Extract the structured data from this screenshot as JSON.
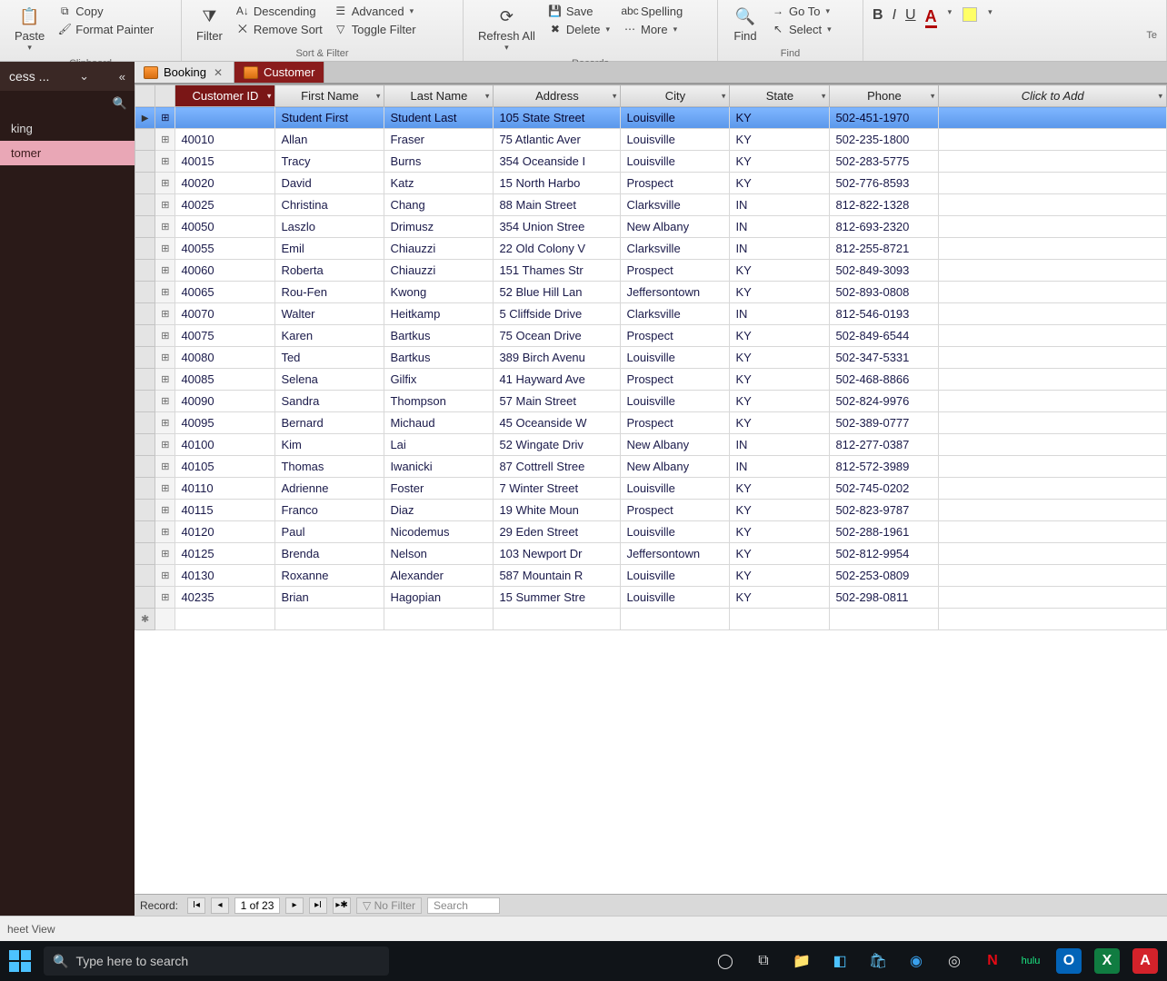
{
  "ribbon": {
    "clipboard": {
      "paste": "Paste",
      "copy": "Copy",
      "painter": "Format Painter",
      "group": "Clipboard"
    },
    "sortfilter": {
      "filter": "Filter",
      "desc": "Descending",
      "remove": "Remove Sort",
      "adv": "Advanced",
      "toggle": "Toggle Filter",
      "group": "Sort & Filter"
    },
    "records": {
      "refresh": "Refresh All",
      "save": "Save",
      "delete": "Delete",
      "spelling": "Spelling",
      "more": "More",
      "group": "Records"
    },
    "find": {
      "find": "Find",
      "goto": "Go To",
      "select": "Select",
      "group": "Find"
    },
    "textfmt": {
      "group": "Te"
    }
  },
  "nav": {
    "title": "cess ...",
    "items": [
      {
        "label": "king"
      },
      {
        "label": "tomer"
      }
    ]
  },
  "tabs": [
    {
      "label": "Booking",
      "active": false
    },
    {
      "label": "Customer",
      "active": true
    }
  ],
  "columns": [
    "Customer ID",
    "First Name",
    "Last Name",
    "Address",
    "City",
    "State",
    "Phone",
    "Click to Add"
  ],
  "rows": [
    {
      "id": "",
      "fn": "Student First",
      "ln": "Student Last",
      "addr": "105 State Street",
      "city": "Louisville",
      "state": "KY",
      "phone": "502-451-1970",
      "sel": true
    },
    {
      "id": "40010",
      "fn": "Allan",
      "ln": "Fraser",
      "addr": "75 Atlantic Aver",
      "city": "Louisville",
      "state": "KY",
      "phone": "502-235-1800"
    },
    {
      "id": "40015",
      "fn": "Tracy",
      "ln": "Burns",
      "addr": "354 Oceanside I",
      "city": "Louisville",
      "state": "KY",
      "phone": "502-283-5775"
    },
    {
      "id": "40020",
      "fn": "David",
      "ln": "Katz",
      "addr": "15 North Harbo",
      "city": "Prospect",
      "state": "KY",
      "phone": "502-776-8593"
    },
    {
      "id": "40025",
      "fn": "Christina",
      "ln": "Chang",
      "addr": "88 Main Street",
      "city": "Clarksville",
      "state": "IN",
      "phone": "812-822-1328"
    },
    {
      "id": "40050",
      "fn": "Laszlo",
      "ln": "Drimusz",
      "addr": "354 Union Stree",
      "city": "New Albany",
      "state": "IN",
      "phone": "812-693-2320"
    },
    {
      "id": "40055",
      "fn": "Emil",
      "ln": "Chiauzzi",
      "addr": "22 Old Colony V",
      "city": "Clarksville",
      "state": "IN",
      "phone": "812-255-8721"
    },
    {
      "id": "40060",
      "fn": "Roberta",
      "ln": "Chiauzzi",
      "addr": "151 Thames Str",
      "city": "Prospect",
      "state": "KY",
      "phone": "502-849-3093"
    },
    {
      "id": "40065",
      "fn": "Rou-Fen",
      "ln": "Kwong",
      "addr": "52 Blue Hill Lan",
      "city": "Jeffersontown",
      "state": "KY",
      "phone": "502-893-0808"
    },
    {
      "id": "40070",
      "fn": "Walter",
      "ln": "Heitkamp",
      "addr": "5 Cliffside Drive",
      "city": "Clarksville",
      "state": "IN",
      "phone": "812-546-0193"
    },
    {
      "id": "40075",
      "fn": "Karen",
      "ln": "Bartkus",
      "addr": "75 Ocean Drive",
      "city": "Prospect",
      "state": "KY",
      "phone": "502-849-6544"
    },
    {
      "id": "40080",
      "fn": "Ted",
      "ln": "Bartkus",
      "addr": "389 Birch Avenu",
      "city": "Louisville",
      "state": "KY",
      "phone": "502-347-5331"
    },
    {
      "id": "40085",
      "fn": "Selena",
      "ln": "Gilfix",
      "addr": "41 Hayward Ave",
      "city": "Prospect",
      "state": "KY",
      "phone": "502-468-8866"
    },
    {
      "id": "40090",
      "fn": "Sandra",
      "ln": "Thompson",
      "addr": "57 Main Street",
      "city": "Louisville",
      "state": "KY",
      "phone": "502-824-9976"
    },
    {
      "id": "40095",
      "fn": "Bernard",
      "ln": "Michaud",
      "addr": "45 Oceanside W",
      "city": "Prospect",
      "state": "KY",
      "phone": "502-389-0777"
    },
    {
      "id": "40100",
      "fn": "Kim",
      "ln": "Lai",
      "addr": "52 Wingate Driv",
      "city": "New Albany",
      "state": "IN",
      "phone": "812-277-0387"
    },
    {
      "id": "40105",
      "fn": "Thomas",
      "ln": "Iwanicki",
      "addr": "87 Cottrell Stree",
      "city": "New Albany",
      "state": "IN",
      "phone": "812-572-3989"
    },
    {
      "id": "40110",
      "fn": "Adrienne",
      "ln": "Foster",
      "addr": "7 Winter Street",
      "city": "Louisville",
      "state": "KY",
      "phone": "502-745-0202"
    },
    {
      "id": "40115",
      "fn": "Franco",
      "ln": "Diaz",
      "addr": "19 White Moun",
      "city": "Prospect",
      "state": "KY",
      "phone": "502-823-9787"
    },
    {
      "id": "40120",
      "fn": "Paul",
      "ln": "Nicodemus",
      "addr": "29 Eden Street",
      "city": "Louisville",
      "state": "KY",
      "phone": "502-288-1961"
    },
    {
      "id": "40125",
      "fn": "Brenda",
      "ln": "Nelson",
      "addr": "103 Newport Dr",
      "city": "Jeffersontown",
      "state": "KY",
      "phone": "502-812-9954"
    },
    {
      "id": "40130",
      "fn": "Roxanne",
      "ln": "Alexander",
      "addr": "587 Mountain R",
      "city": "Louisville",
      "state": "KY",
      "phone": "502-253-0809"
    },
    {
      "id": "40235",
      "fn": "Brian",
      "ln": "Hagopian",
      "addr": "15 Summer Stre",
      "city": "Louisville",
      "state": "KY",
      "phone": "502-298-0811"
    }
  ],
  "recnav": {
    "label": "Record:",
    "pos": "1 of 23",
    "nofilter": "No Filter",
    "search": "Search"
  },
  "status": {
    "view": "heet View"
  },
  "taskbar": {
    "search": "Type here to search"
  }
}
